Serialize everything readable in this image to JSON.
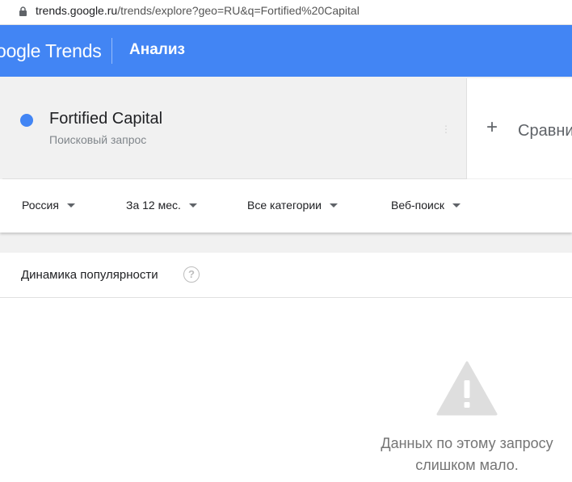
{
  "browser": {
    "url_host": "trends.google.ru",
    "url_path": "/trends/explore?geo=RU&q=Fortified%20Capital"
  },
  "header": {
    "logo": "oogle Trends",
    "title": "Анализ"
  },
  "term": {
    "name": "Fortified Capital",
    "type": "Поисковый запрос",
    "color": "#4285f4"
  },
  "compare": {
    "label": "Сравни"
  },
  "filters": {
    "region": "Россия",
    "period": "За 12 мес.",
    "category": "Все категории",
    "search_type": "Веб-поиск"
  },
  "widget": {
    "title": "Динамика популярности",
    "empty_line1": "Данных по этому запросу",
    "empty_line2": "слишком мало."
  },
  "colors": {
    "brand": "#4285f4",
    "icon_gray": "#bdbdbd"
  }
}
